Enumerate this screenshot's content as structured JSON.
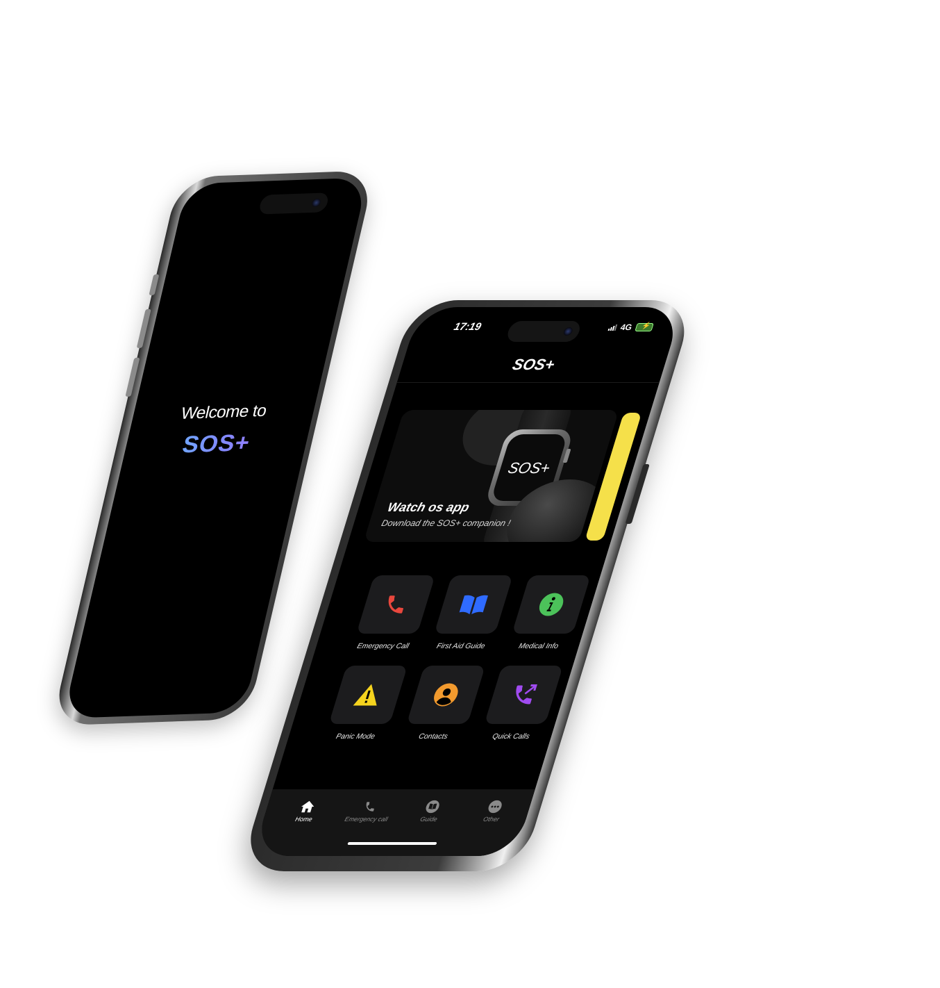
{
  "welcome_screen": {
    "welcome_text": "Welcome to",
    "brand_text": "SOS+"
  },
  "status_bar": {
    "time": "17:19",
    "network": "4G",
    "icons": [
      "signal-icon",
      "battery-charging-icon"
    ]
  },
  "app": {
    "title": "SOS+"
  },
  "banner": {
    "watch_label": "SOS+",
    "title": "Watch os app",
    "subtitle": "Download the SOS+ companion !",
    "next_card_color": "#F5E04A"
  },
  "features": [
    {
      "label": "Emergency Call",
      "icon": "phone-icon",
      "color": "#E8473D"
    },
    {
      "label": "First Aid Guide",
      "icon": "book-icon",
      "color": "#2F6BFF"
    },
    {
      "label": "Medical Info",
      "icon": "info-icon",
      "color": "#4CC25A"
    },
    {
      "label": "Panic Mode",
      "icon": "warning-icon",
      "color": "#F5D31E"
    },
    {
      "label": "Contacts",
      "icon": "person-icon",
      "color": "#F29A2E"
    },
    {
      "label": "Quick Calls",
      "icon": "outgoing-call-icon",
      "color": "#A04BF0"
    }
  ],
  "tabs": [
    {
      "label": "Home",
      "icon": "house-icon",
      "active": true
    },
    {
      "label": "Emergency call",
      "icon": "phone-icon",
      "active": false
    },
    {
      "label": "Guide",
      "icon": "book-icon",
      "active": false
    },
    {
      "label": "Other",
      "icon": "ellipsis-icon",
      "active": false
    }
  ],
  "colors": {
    "background": "#FFFFFF",
    "screen": "#000000",
    "tile": "#1C1C1E",
    "brand_gradient": [
      "#5AD0FF",
      "#7F8CFF",
      "#B06BFF"
    ]
  }
}
